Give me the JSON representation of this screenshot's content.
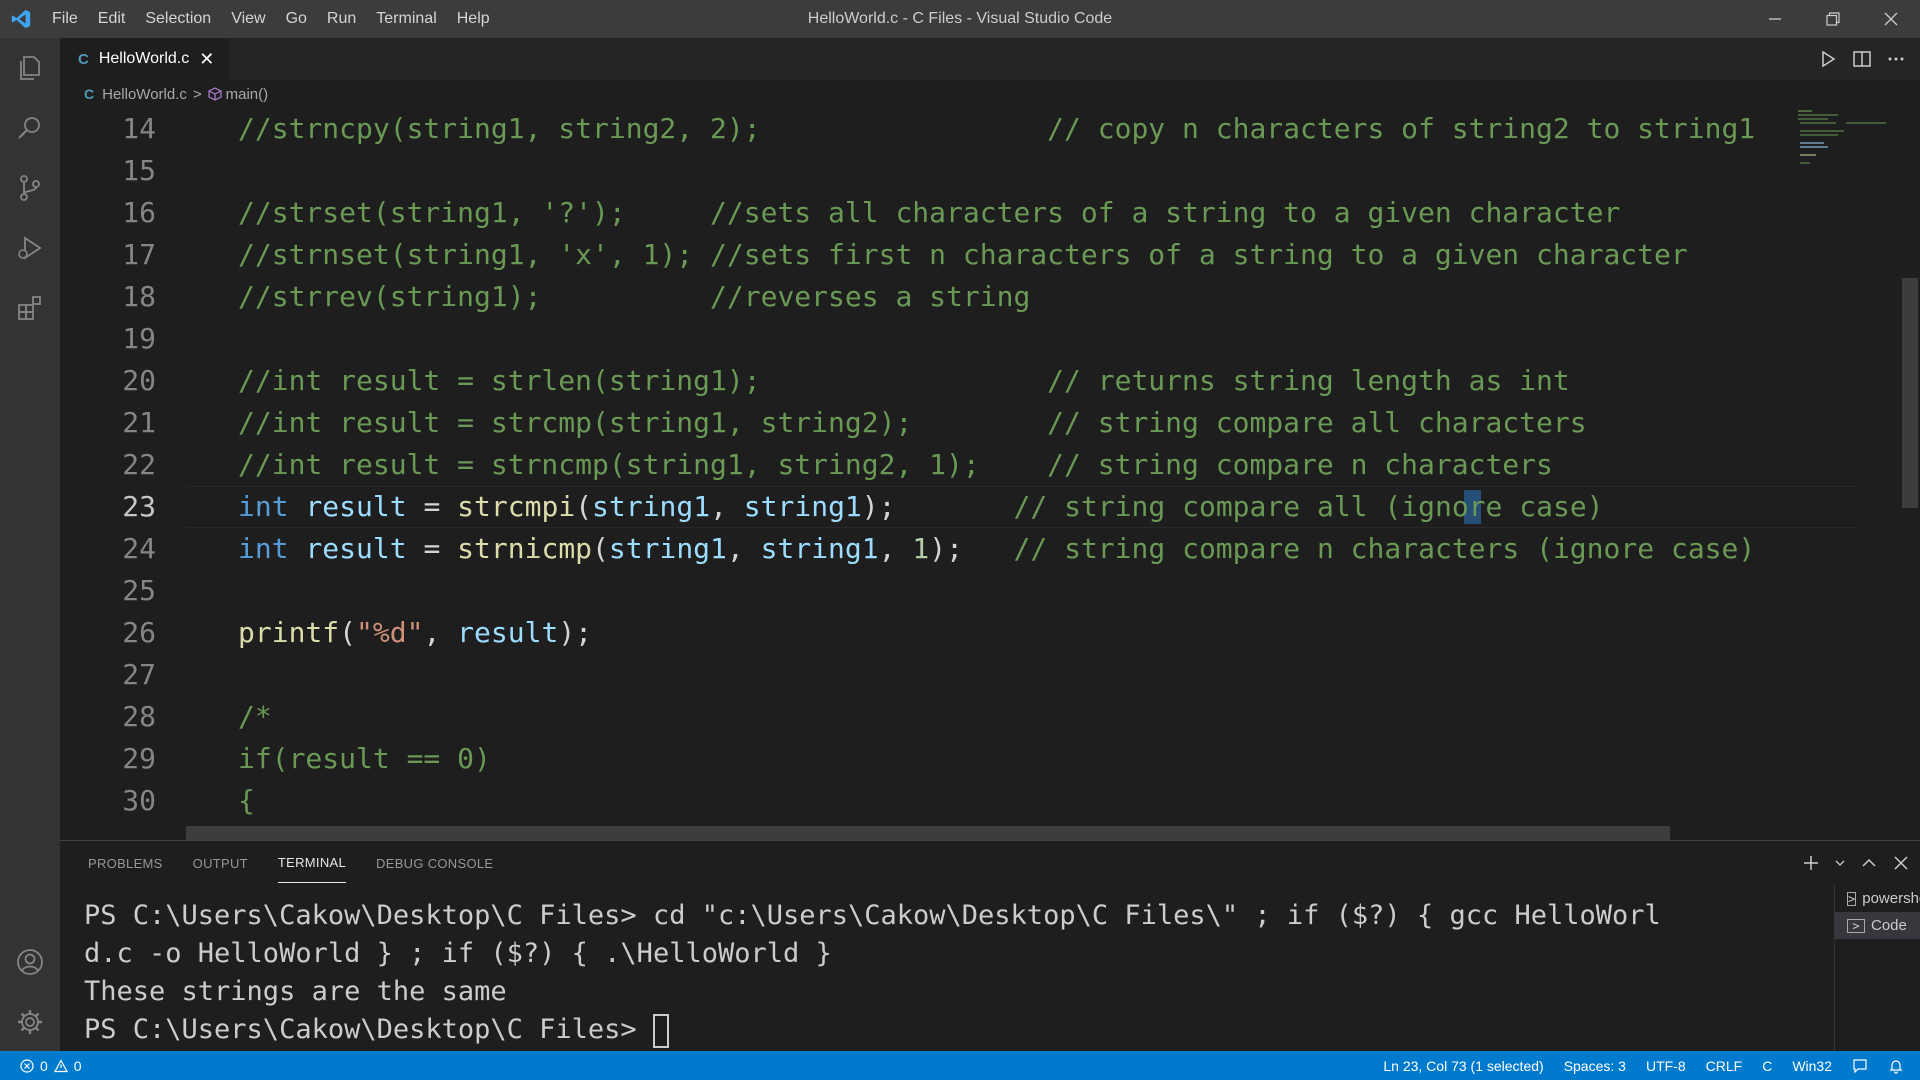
{
  "window": {
    "title": "HelloWorld.c - C Files - Visual Studio Code",
    "menu": [
      "File",
      "Edit",
      "Selection",
      "View",
      "Go",
      "Run",
      "Terminal",
      "Help"
    ]
  },
  "activity_bar": {
    "items": [
      "explorer-icon",
      "search-icon",
      "source-control-icon",
      "run-debug-icon",
      "extensions-icon"
    ],
    "bottom": [
      "account-icon",
      "settings-gear-icon"
    ]
  },
  "tab": {
    "label": "HelloWorld.c",
    "lang_badge": "C",
    "close": "✕"
  },
  "breadcrumb": {
    "file": "HelloWorld.c",
    "symbol": "main()",
    "separator": ">"
  },
  "editor": {
    "active_line": "23",
    "line_numbers": [
      "14",
      "15",
      "16",
      "17",
      "18",
      "19",
      "20",
      "21",
      "22",
      "23",
      "24",
      "25",
      "26",
      "27",
      "28",
      "29",
      "30"
    ]
  },
  "panel": {
    "tabs": [
      "PROBLEMS",
      "OUTPUT",
      "TERMINAL",
      "DEBUG CONSOLE"
    ],
    "active_tab": "TERMINAL",
    "terminal_lines": [
      "PS C:\\Users\\Cakow\\Desktop\\C Files> cd \"c:\\Users\\Cakow\\Desktop\\C Files\\\" ; if ($?) { gcc HelloWorl",
      "d.c -o HelloWorld } ; if ($?) { .\\HelloWorld }",
      "These strings are the same",
      "PS C:\\Users\\Cakow\\Desktop\\C Files> "
    ],
    "terminals": [
      "powershell",
      "Code"
    ],
    "active_terminal": "Code"
  },
  "status_bar": {
    "errors": "0",
    "warnings": "0",
    "position": "Ln 23, Col 73 (1 selected)",
    "spaces": "Spaces: 3",
    "encoding": "UTF-8",
    "eol": "CRLF",
    "language": "C",
    "platform": "Win32"
  },
  "colors": {
    "accent": "#007acc",
    "comment": "#6a9955",
    "keyword": "#569cd6",
    "variable": "#9cdcfe",
    "function": "#dcdcaa",
    "string": "#ce9178",
    "number": "#b5cea8"
  }
}
